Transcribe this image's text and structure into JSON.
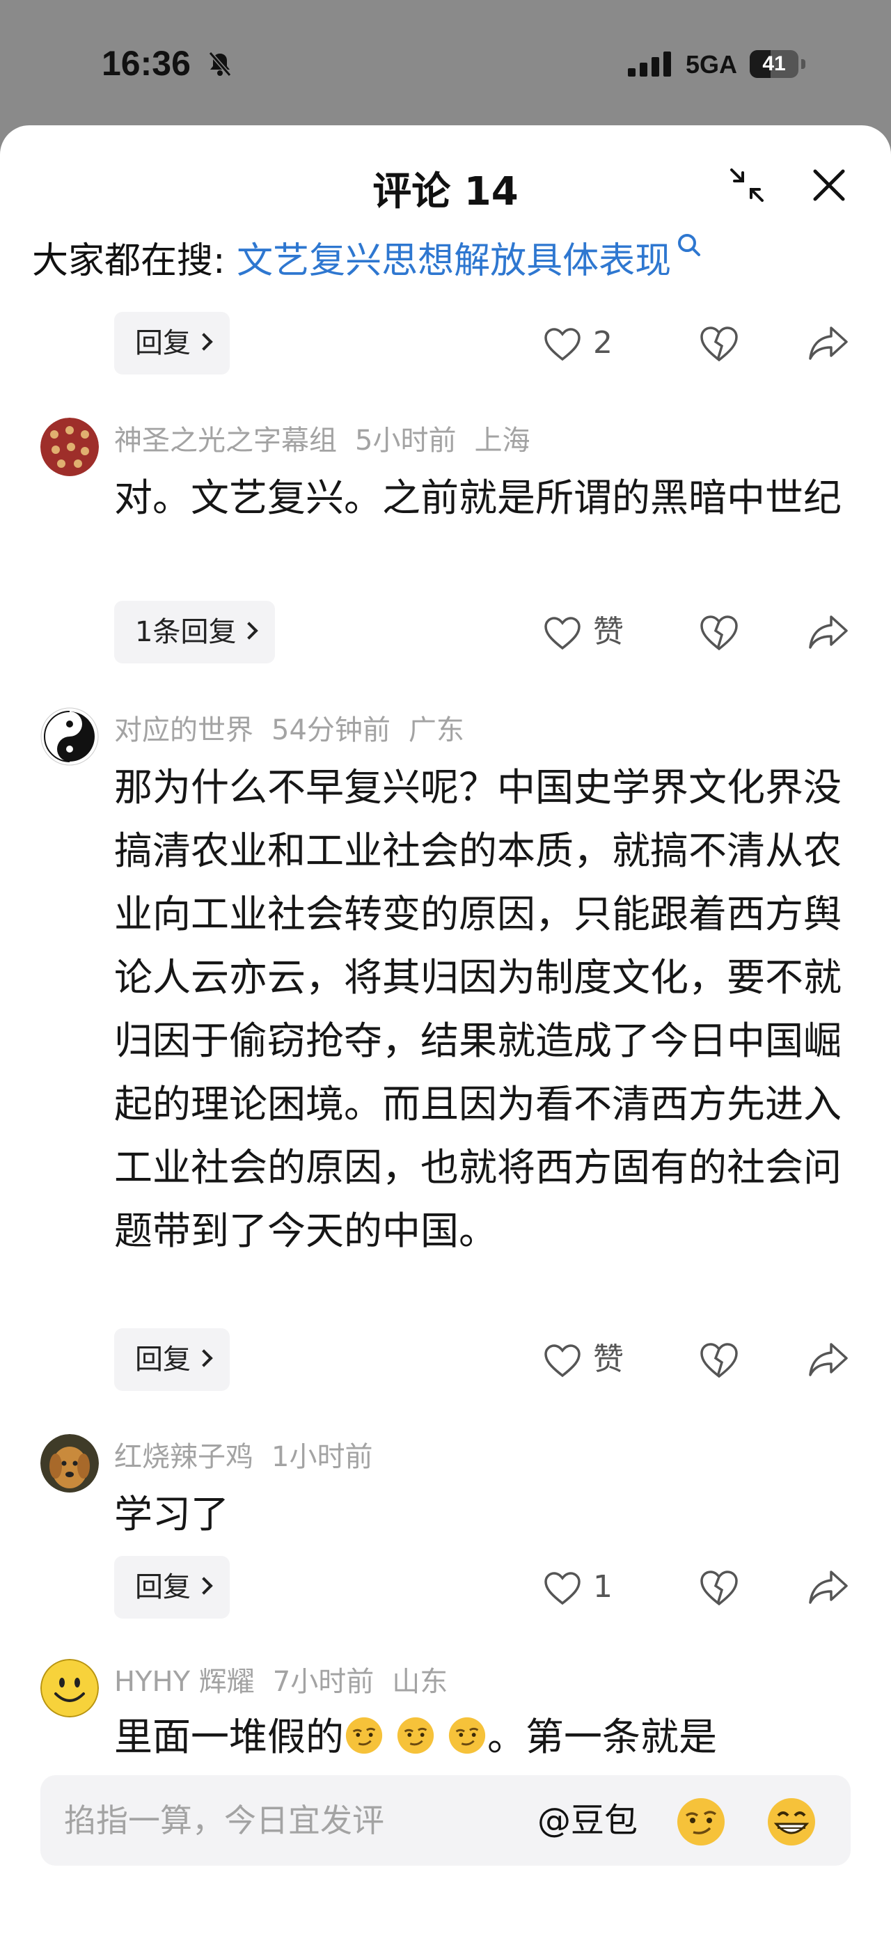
{
  "status_bar": {
    "time": "16:36",
    "network": "5GA",
    "battery": "41"
  },
  "sheet": {
    "title": "评论 14",
    "search_prefix": "大家都在搜: ",
    "search_link": "文艺复兴思想解放具体表现"
  },
  "comments": [
    {
      "reply_label": "回复",
      "like_label": "2"
    },
    {
      "username": "神圣之光之字幕组",
      "time": "5小时前",
      "location": "上海",
      "text": "对。文艺复兴。之前就是所谓的黑暗中世纪",
      "reply_label": "1条回复",
      "like_label": "赞"
    },
    {
      "username": "对应的世界",
      "time": "54分钟前",
      "location": "广东",
      "text": "那为什么不早复兴呢？中国史学界文化界没搞清农业和工业社会的本质，就搞不清从农业向工业社会转变的原因，只能跟着西方舆论人云亦云，将其归因为制度文化，要不就归因于偷窃抢夺，结果就造成了今日中国崛起的理论困境。而且因为看不清西方先进入工业社会的原因，也就将西方固有的社会问题带到了今天的中国。",
      "reply_label": "回复",
      "like_label": "赞"
    },
    {
      "username": "红烧辣子鸡",
      "time": "1小时前",
      "location": "",
      "text": "学习了",
      "reply_label": "回复",
      "like_label": "1"
    },
    {
      "username": "HYHY 辉耀",
      "time": "7小时前",
      "location": "山东",
      "text_before": "里面一堆假的",
      "text_after": "。第一条就是"
    }
  ],
  "input_bar": {
    "placeholder": "掐指一算，今日宜发评",
    "mention": "@豆包"
  },
  "icons": {
    "mute": "bell-slash-icon",
    "collapse": "collapse-arrows-icon",
    "close": "close-icon",
    "like": "heart-outline-icon",
    "dislike": "broken-heart-icon",
    "share": "share-arrow-icon",
    "emoji_1": "smirk-emoji",
    "emoji_2": "grin-emoji"
  },
  "colors": {
    "link": "#2e77d0",
    "meta_text": "#a3a3a3",
    "reply_bg": "#f3f3f5",
    "dim_background": "#8a8a8a"
  }
}
